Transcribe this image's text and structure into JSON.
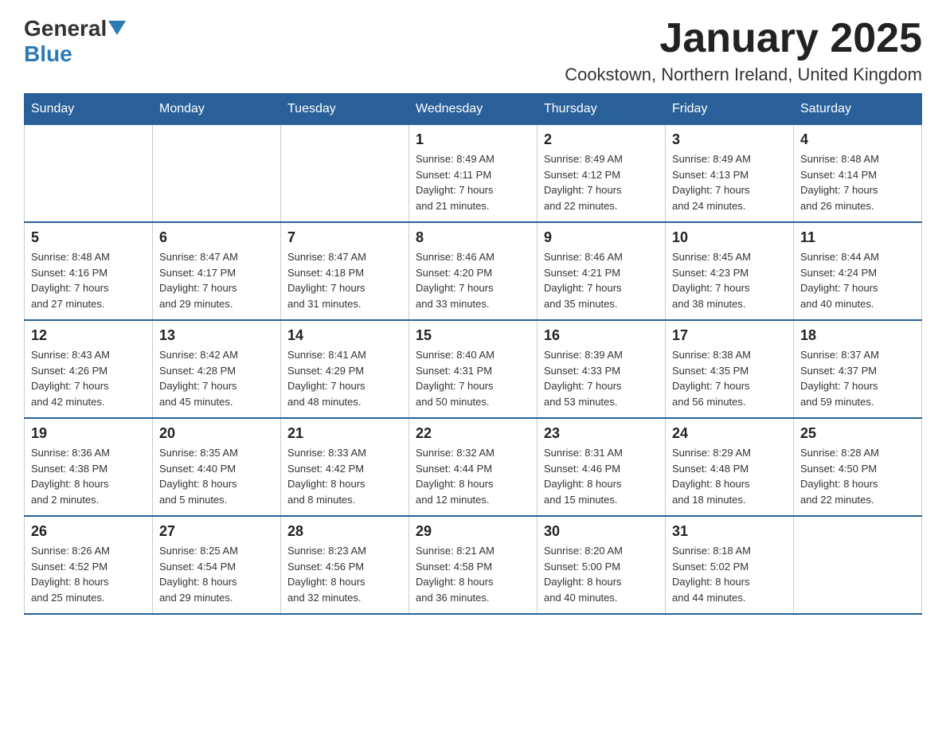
{
  "header": {
    "logo_general": "General",
    "logo_blue": "Blue",
    "title": "January 2025",
    "subtitle": "Cookstown, Northern Ireland, United Kingdom"
  },
  "days_of_week": [
    "Sunday",
    "Monday",
    "Tuesday",
    "Wednesday",
    "Thursday",
    "Friday",
    "Saturday"
  ],
  "weeks": [
    [
      {
        "day": "",
        "info": ""
      },
      {
        "day": "",
        "info": ""
      },
      {
        "day": "",
        "info": ""
      },
      {
        "day": "1",
        "info": "Sunrise: 8:49 AM\nSunset: 4:11 PM\nDaylight: 7 hours\nand 21 minutes."
      },
      {
        "day": "2",
        "info": "Sunrise: 8:49 AM\nSunset: 4:12 PM\nDaylight: 7 hours\nand 22 minutes."
      },
      {
        "day": "3",
        "info": "Sunrise: 8:49 AM\nSunset: 4:13 PM\nDaylight: 7 hours\nand 24 minutes."
      },
      {
        "day": "4",
        "info": "Sunrise: 8:48 AM\nSunset: 4:14 PM\nDaylight: 7 hours\nand 26 minutes."
      }
    ],
    [
      {
        "day": "5",
        "info": "Sunrise: 8:48 AM\nSunset: 4:16 PM\nDaylight: 7 hours\nand 27 minutes."
      },
      {
        "day": "6",
        "info": "Sunrise: 8:47 AM\nSunset: 4:17 PM\nDaylight: 7 hours\nand 29 minutes."
      },
      {
        "day": "7",
        "info": "Sunrise: 8:47 AM\nSunset: 4:18 PM\nDaylight: 7 hours\nand 31 minutes."
      },
      {
        "day": "8",
        "info": "Sunrise: 8:46 AM\nSunset: 4:20 PM\nDaylight: 7 hours\nand 33 minutes."
      },
      {
        "day": "9",
        "info": "Sunrise: 8:46 AM\nSunset: 4:21 PM\nDaylight: 7 hours\nand 35 minutes."
      },
      {
        "day": "10",
        "info": "Sunrise: 8:45 AM\nSunset: 4:23 PM\nDaylight: 7 hours\nand 38 minutes."
      },
      {
        "day": "11",
        "info": "Sunrise: 8:44 AM\nSunset: 4:24 PM\nDaylight: 7 hours\nand 40 minutes."
      }
    ],
    [
      {
        "day": "12",
        "info": "Sunrise: 8:43 AM\nSunset: 4:26 PM\nDaylight: 7 hours\nand 42 minutes."
      },
      {
        "day": "13",
        "info": "Sunrise: 8:42 AM\nSunset: 4:28 PM\nDaylight: 7 hours\nand 45 minutes."
      },
      {
        "day": "14",
        "info": "Sunrise: 8:41 AM\nSunset: 4:29 PM\nDaylight: 7 hours\nand 48 minutes."
      },
      {
        "day": "15",
        "info": "Sunrise: 8:40 AM\nSunset: 4:31 PM\nDaylight: 7 hours\nand 50 minutes."
      },
      {
        "day": "16",
        "info": "Sunrise: 8:39 AM\nSunset: 4:33 PM\nDaylight: 7 hours\nand 53 minutes."
      },
      {
        "day": "17",
        "info": "Sunrise: 8:38 AM\nSunset: 4:35 PM\nDaylight: 7 hours\nand 56 minutes."
      },
      {
        "day": "18",
        "info": "Sunrise: 8:37 AM\nSunset: 4:37 PM\nDaylight: 7 hours\nand 59 minutes."
      }
    ],
    [
      {
        "day": "19",
        "info": "Sunrise: 8:36 AM\nSunset: 4:38 PM\nDaylight: 8 hours\nand 2 minutes."
      },
      {
        "day": "20",
        "info": "Sunrise: 8:35 AM\nSunset: 4:40 PM\nDaylight: 8 hours\nand 5 minutes."
      },
      {
        "day": "21",
        "info": "Sunrise: 8:33 AM\nSunset: 4:42 PM\nDaylight: 8 hours\nand 8 minutes."
      },
      {
        "day": "22",
        "info": "Sunrise: 8:32 AM\nSunset: 4:44 PM\nDaylight: 8 hours\nand 12 minutes."
      },
      {
        "day": "23",
        "info": "Sunrise: 8:31 AM\nSunset: 4:46 PM\nDaylight: 8 hours\nand 15 minutes."
      },
      {
        "day": "24",
        "info": "Sunrise: 8:29 AM\nSunset: 4:48 PM\nDaylight: 8 hours\nand 18 minutes."
      },
      {
        "day": "25",
        "info": "Sunrise: 8:28 AM\nSunset: 4:50 PM\nDaylight: 8 hours\nand 22 minutes."
      }
    ],
    [
      {
        "day": "26",
        "info": "Sunrise: 8:26 AM\nSunset: 4:52 PM\nDaylight: 8 hours\nand 25 minutes."
      },
      {
        "day": "27",
        "info": "Sunrise: 8:25 AM\nSunset: 4:54 PM\nDaylight: 8 hours\nand 29 minutes."
      },
      {
        "day": "28",
        "info": "Sunrise: 8:23 AM\nSunset: 4:56 PM\nDaylight: 8 hours\nand 32 minutes."
      },
      {
        "day": "29",
        "info": "Sunrise: 8:21 AM\nSunset: 4:58 PM\nDaylight: 8 hours\nand 36 minutes."
      },
      {
        "day": "30",
        "info": "Sunrise: 8:20 AM\nSunset: 5:00 PM\nDaylight: 8 hours\nand 40 minutes."
      },
      {
        "day": "31",
        "info": "Sunrise: 8:18 AM\nSunset: 5:02 PM\nDaylight: 8 hours\nand 44 minutes."
      },
      {
        "day": "",
        "info": ""
      }
    ]
  ]
}
